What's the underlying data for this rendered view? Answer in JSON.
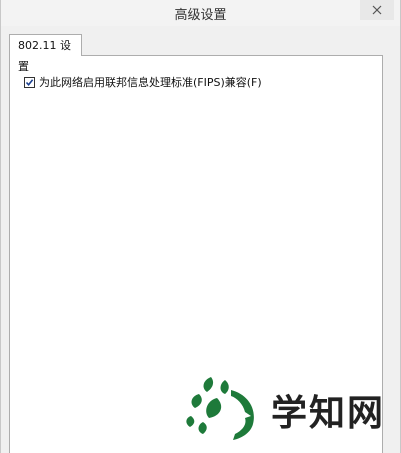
{
  "window": {
    "title": "高级设置"
  },
  "tabs": [
    {
      "label": "802.11 设置",
      "selected": true
    }
  ],
  "settings": {
    "fips_checkbox": {
      "label": "为此网络启用联邦信息处理标准(FIPS)兼容(F)",
      "checked": true
    }
  },
  "watermark": {
    "text": "学知网",
    "logo_icon": "leaf-logo-icon",
    "logo_color": "#1e7a3a"
  },
  "colors": {
    "background": "#f0f0f0",
    "panel": "#ffffff",
    "border": "#adadad"
  }
}
